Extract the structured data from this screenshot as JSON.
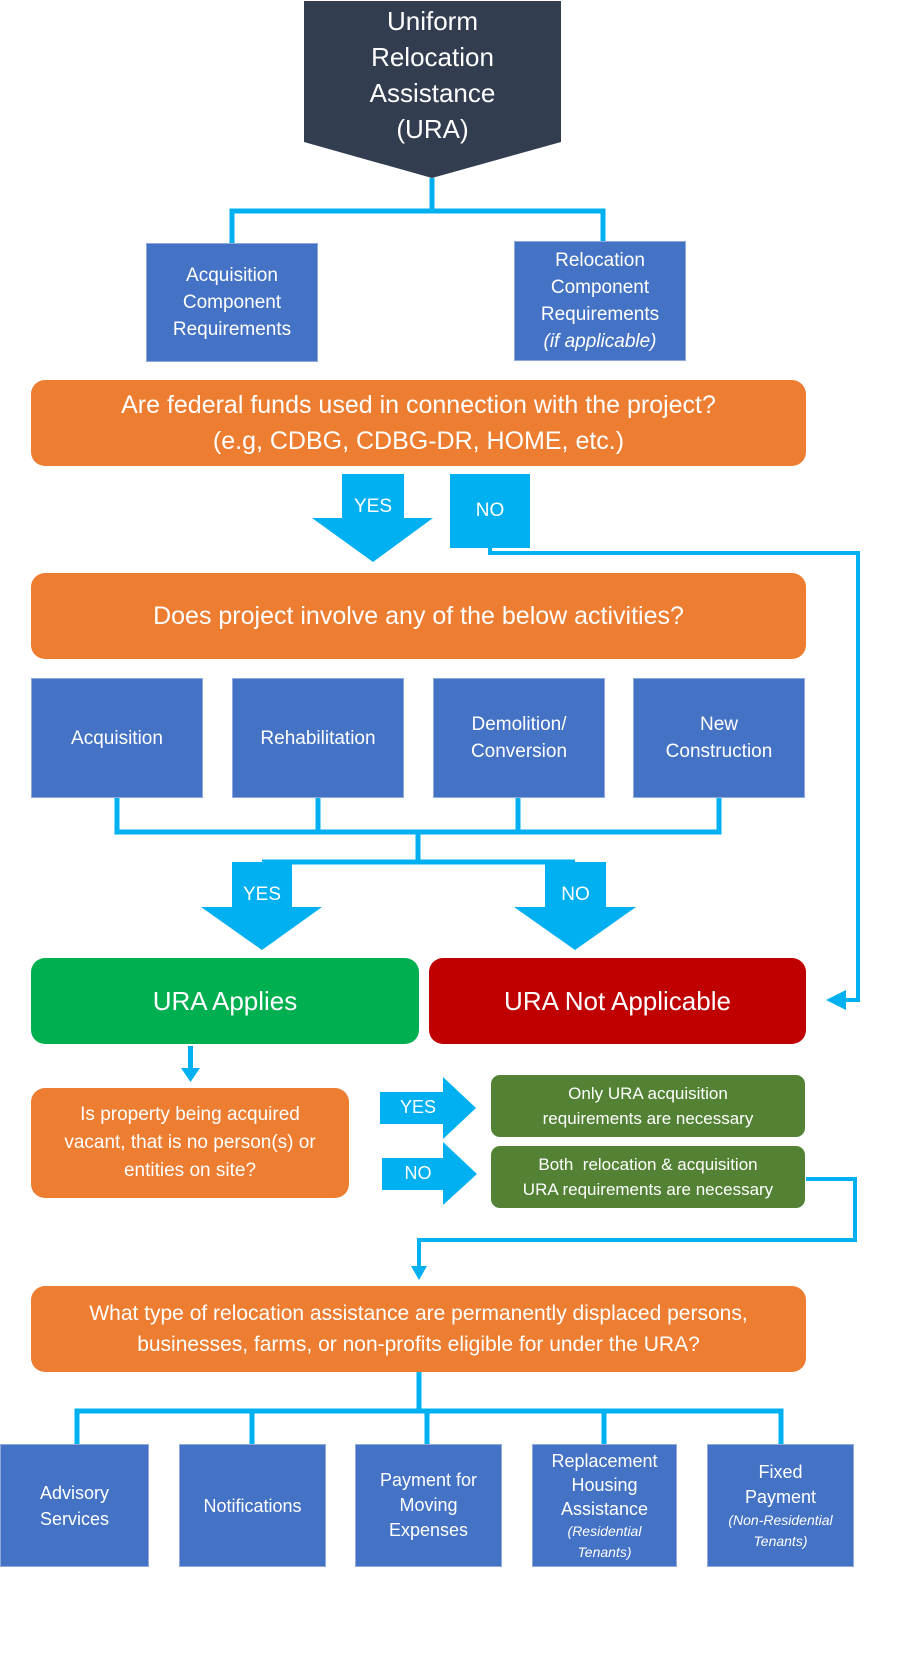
{
  "title": {
    "lines": [
      "Uniform",
      "Relocation",
      "Assistance",
      "(URA)"
    ]
  },
  "components": [
    {
      "lines": [
        "Acquisition",
        "Component",
        "Requirements"
      ],
      "note": ""
    },
    {
      "lines": [
        "Relocation",
        "Component",
        "Requirements"
      ],
      "note": "(if applicable)"
    }
  ],
  "question1": {
    "line1": "Are federal funds used in connection with the project?",
    "line2": "(e.g, CDBG, CDBG-DR, HOME, etc.)",
    "yes_label": "YES",
    "no_label": "NO"
  },
  "question2": {
    "text": "Does project involve any of the below activities?",
    "activities": [
      {
        "lines": [
          "Acquisition"
        ]
      },
      {
        "lines": [
          "Rehabilitation"
        ]
      },
      {
        "lines": [
          "Demolition/",
          "Conversion"
        ]
      },
      {
        "lines": [
          "New",
          "Construction"
        ]
      }
    ],
    "yes_label": "YES",
    "no_label": "NO"
  },
  "outcomes": {
    "applies": "URA Applies",
    "not_applicable": "URA Not Applicable"
  },
  "question3": {
    "lines": [
      "Is property being acquired",
      "vacant, that is no person(s) or",
      "entities on site?"
    ],
    "yes_label": "YES",
    "no_label": "NO",
    "yes_result": [
      "Only URA acquisition",
      "requirements are necessary"
    ],
    "no_result": [
      "Both  relocation & acquisition",
      "URA requirements are necessary"
    ]
  },
  "question4": {
    "line1": "What type of relocation assistance are permanently displaced persons,",
    "line2": "businesses, farms, or non-profits eligible for under the URA?",
    "assistance": [
      {
        "lines": [
          "Advisory",
          "Services"
        ],
        "note": ""
      },
      {
        "lines": [
          "Notifications"
        ],
        "note": ""
      },
      {
        "lines": [
          "Payment for",
          "Moving",
          "Expenses"
        ],
        "note": ""
      },
      {
        "lines": [
          "Replacement",
          "Housing",
          "Assistance"
        ],
        "note_lines": [
          "(Residential",
          "Tenants)"
        ]
      },
      {
        "lines": [
          "Fixed",
          "Payment"
        ],
        "note_lines": [
          "(Non-Residential",
          "Tenants)"
        ]
      }
    ]
  },
  "colors": {
    "title_bg": "#323d50",
    "box_blue": "#4472c4",
    "question_orange": "#ed7d31",
    "connector_cyan": "#00b0f0",
    "applies_green": "#00b050",
    "not_applicable_red": "#c00000",
    "result_green": "#548235"
  }
}
